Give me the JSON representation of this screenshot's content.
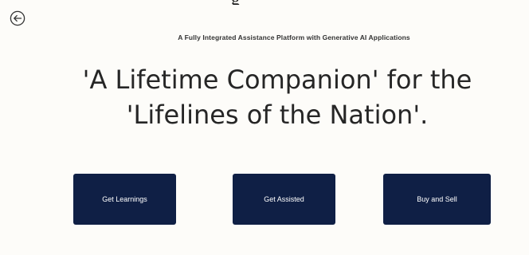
{
  "header": {
    "partial_top_text": "g"
  },
  "navigation": {
    "back_icon": "back-arrow-circle-icon"
  },
  "hero": {
    "tagline": "A Fully Integrated Assistance Platform with Generative AI Applications",
    "headline_line1": "'A Lifetime Companion' for the",
    "headline_line2": "'Lifelines of the Nation'."
  },
  "actions": {
    "get_learnings": "Get Learnings",
    "get_assisted": "Get Assisted",
    "buy_and_sell": "Buy and Sell"
  },
  "colors": {
    "background": "#fdfcf9",
    "button_bg": "#0f1f45",
    "button_text": "#ffffff",
    "headline_text": "#262626"
  }
}
